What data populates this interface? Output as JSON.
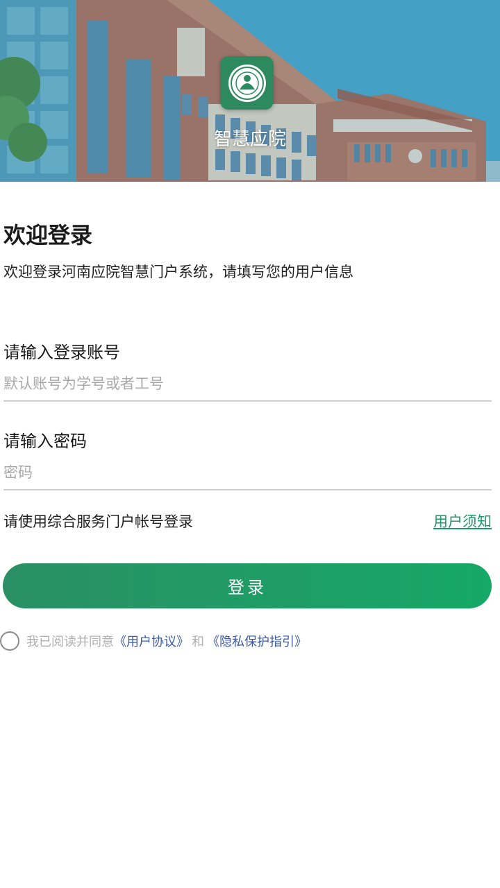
{
  "header": {
    "app_name": "智慧应院"
  },
  "welcome": {
    "title": "欢迎登录",
    "subtitle": "欢迎登录河南应院智慧门户系统，请填写您的用户信息"
  },
  "account": {
    "label": "请输入登录账号",
    "placeholder": "默认账号为学号或者工号",
    "value": ""
  },
  "password": {
    "label": "请输入密码",
    "placeholder": "密码",
    "value": ""
  },
  "hint": {
    "text": "请使用综合服务门户帐号登录",
    "notice_link": "用户须知"
  },
  "login_button": {
    "label": "登录"
  },
  "agreement": {
    "checked": false,
    "prefix": "我已阅读并同意",
    "user_agreement": "《用户协议》",
    "and": "和",
    "privacy_policy": "《隐私保护指引》"
  },
  "colors": {
    "accent": "#1a9a6a",
    "button_start": "#2a8f64",
    "button_end": "#16a866",
    "link_blue": "#3b5ba8"
  },
  "icons": {
    "app_logo": "school-emblem-icon",
    "radio": "radio-unchecked-icon"
  }
}
